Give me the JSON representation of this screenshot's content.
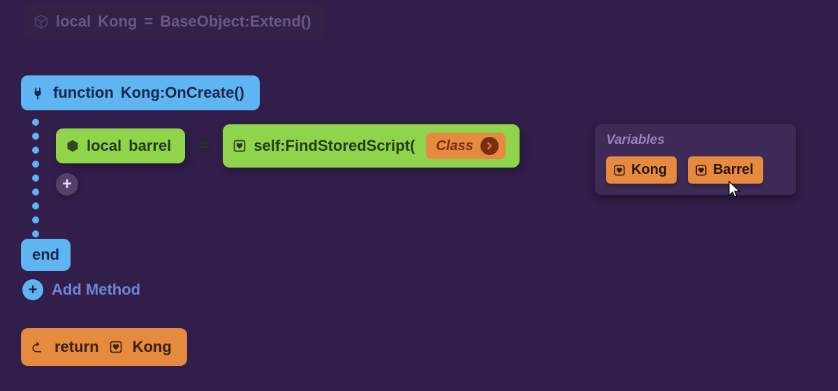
{
  "topBlock": {
    "local": "local",
    "name": "Kong",
    "eq": "=",
    "base": "BaseObject:Extend()"
  },
  "func": {
    "keyword": "function",
    "signature": "Kong:OnCreate()",
    "end": "end"
  },
  "barrel": {
    "local": "local",
    "name": "barrel",
    "eq": "=",
    "call": "self:FindStoredScript(",
    "slotLabel": "Class"
  },
  "addMethod": "Add Method",
  "ret": {
    "keyword": "return",
    "value": "Kong"
  },
  "vars": {
    "title": "Variables",
    "items": [
      "Kong",
      "Barrel"
    ]
  }
}
